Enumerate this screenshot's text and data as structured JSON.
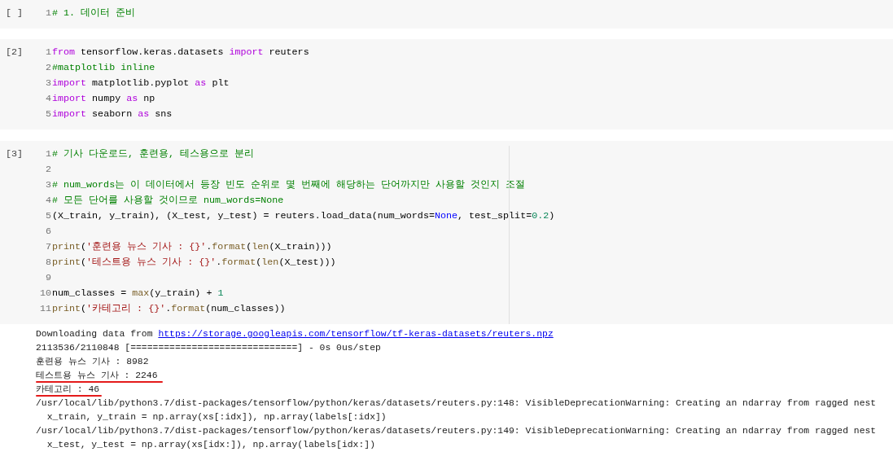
{
  "cells": [
    {
      "execution_count": "[ ]",
      "show_ruler": false,
      "lines": [
        {
          "number": "1",
          "tokens": [
            {
              "kind": "comment",
              "text": "# 1. 데이터 준비"
            }
          ]
        }
      ]
    },
    {
      "execution_count": "[2]",
      "show_ruler": false,
      "lines": [
        {
          "number": "1",
          "tokens": [
            {
              "kind": "keyword",
              "text": "from"
            },
            {
              "kind": "plain",
              "text": " tensorflow.keras.datasets "
            },
            {
              "kind": "keyword",
              "text": "import"
            },
            {
              "kind": "plain",
              "text": " reuters"
            }
          ]
        },
        {
          "number": "2",
          "tokens": [
            {
              "kind": "comment",
              "text": "#matplotlib inline"
            }
          ]
        },
        {
          "number": "3",
          "tokens": [
            {
              "kind": "keyword",
              "text": "import"
            },
            {
              "kind": "plain",
              "text": " matplotlib.pyplot "
            },
            {
              "kind": "keyword",
              "text": "as"
            },
            {
              "kind": "plain",
              "text": " plt"
            }
          ]
        },
        {
          "number": "4",
          "tokens": [
            {
              "kind": "keyword",
              "text": "import"
            },
            {
              "kind": "plain",
              "text": " numpy "
            },
            {
              "kind": "keyword",
              "text": "as"
            },
            {
              "kind": "plain",
              "text": " np"
            }
          ]
        },
        {
          "number": "5",
          "tokens": [
            {
              "kind": "keyword",
              "text": "import"
            },
            {
              "kind": "plain",
              "text": " seaborn "
            },
            {
              "kind": "keyword",
              "text": "as"
            },
            {
              "kind": "plain",
              "text": " sns"
            }
          ]
        }
      ]
    },
    {
      "execution_count": "[3]",
      "show_ruler": true,
      "lines": [
        {
          "number": "1",
          "tokens": [
            {
              "kind": "comment",
              "text": "# 기사 다운로드, 훈련용, 테스용으로 분리"
            }
          ]
        },
        {
          "number": "2"
        },
        {
          "number": "3",
          "tokens": [
            {
              "kind": "comment",
              "text": "# num_words는 이 데이터에서 등장 빈도 순위로 몇 번째에 해당하는 단어까지만 사용할 것인지 조절"
            }
          ]
        },
        {
          "number": "4",
          "tokens": [
            {
              "kind": "comment",
              "text": "# 모든 단어를 사용할 것이므로 num_words=None"
            }
          ]
        },
        {
          "number": "5",
          "tokens": [
            {
              "kind": "plain",
              "text": "(X_train, y_train), (X_test, y_test) = reuters.load_data(num_words="
            },
            {
              "kind": "constant",
              "text": "None"
            },
            {
              "kind": "plain",
              "text": ", test_split="
            },
            {
              "kind": "number",
              "text": "0.2"
            },
            {
              "kind": "plain",
              "text": ")"
            }
          ]
        },
        {
          "number": "6"
        },
        {
          "number": "7",
          "tokens": [
            {
              "kind": "builtin",
              "text": "print"
            },
            {
              "kind": "plain",
              "text": "("
            },
            {
              "kind": "string",
              "text": "'훈련용 뉴스 기사 : {}'"
            },
            {
              "kind": "plain",
              "text": "."
            },
            {
              "kind": "builtin",
              "text": "format"
            },
            {
              "kind": "plain",
              "text": "("
            },
            {
              "kind": "builtin",
              "text": "len"
            },
            {
              "kind": "plain",
              "text": "(X_train)))"
            }
          ]
        },
        {
          "number": "8",
          "tokens": [
            {
              "kind": "builtin",
              "text": "print"
            },
            {
              "kind": "plain",
              "text": "("
            },
            {
              "kind": "string",
              "text": "'테스트용 뉴스 기사 : {}'"
            },
            {
              "kind": "plain",
              "text": "."
            },
            {
              "kind": "builtin",
              "text": "format"
            },
            {
              "kind": "plain",
              "text": "("
            },
            {
              "kind": "builtin",
              "text": "len"
            },
            {
              "kind": "plain",
              "text": "(X_test)))"
            }
          ]
        },
        {
          "number": "9"
        },
        {
          "number": "10",
          "tokens": [
            {
              "kind": "plain",
              "text": "num_classes = "
            },
            {
              "kind": "builtin",
              "text": "max"
            },
            {
              "kind": "plain",
              "text": "(y_train) + "
            },
            {
              "kind": "number",
              "text": "1"
            }
          ]
        },
        {
          "number": "11",
          "tokens": [
            {
              "kind": "builtin",
              "text": "print"
            },
            {
              "kind": "plain",
              "text": "("
            },
            {
              "kind": "string",
              "text": "'카테고리 : {}'"
            },
            {
              "kind": "plain",
              "text": "."
            },
            {
              "kind": "builtin",
              "text": "format"
            },
            {
              "kind": "plain",
              "text": "(num_classes))"
            }
          ]
        }
      ]
    }
  ],
  "output": [
    {
      "text": "Downloading data from ",
      "link": "https://storage.googleapis.com/tensorflow/tf-keras-datasets/reuters.npz",
      "underlined": false
    },
    {
      "text": "2113536/2110848 [==============================] - 0s 0us/step",
      "underlined": false
    },
    {
      "text": "훈련용 뉴스 기사 : 8982",
      "underlined": false
    },
    {
      "text": "테스트용 뉴스 기사 : 2246",
      "underlined": true
    },
    {
      "text": "카테고리 : 46",
      "underlined": true
    },
    {
      "text": "/usr/local/lib/python3.7/dist-packages/tensorflow/python/keras/datasets/reuters.py:148: VisibleDeprecationWarning: Creating an ndarray from ragged nest",
      "underlined": false
    },
    {
      "text": "  x_train, y_train = np.array(xs[:idx]), np.array(labels[:idx])",
      "underlined": false
    },
    {
      "text": "/usr/local/lib/python3.7/dist-packages/tensorflow/python/keras/datasets/reuters.py:149: VisibleDeprecationWarning: Creating an ndarray from ragged nest",
      "underlined": false
    },
    {
      "text": "  x_test, y_test = np.array(xs[idx:]), np.array(labels[idx:])",
      "underlined": false
    }
  ]
}
